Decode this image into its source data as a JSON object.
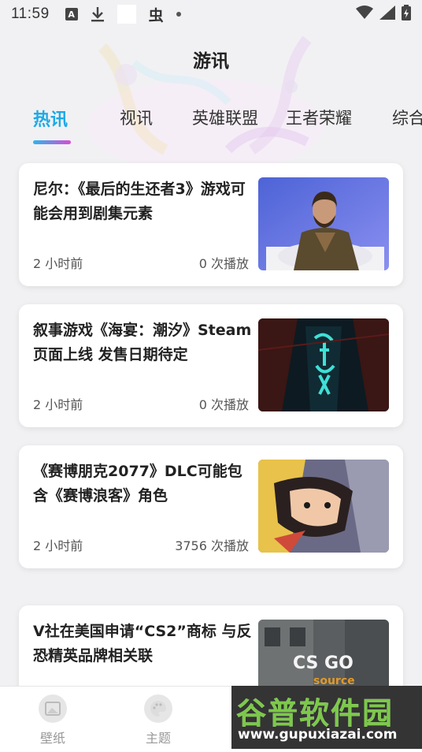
{
  "status_bar": {
    "time": "11:59",
    "icons": [
      "text-a-icon",
      "download-icon",
      "blank-square",
      "bug-icon",
      "notification-dot",
      "wifi-icon",
      "cell-signal-icon",
      "battery-icon"
    ],
    "bug_glyph": "虫",
    "a_glyph": "A"
  },
  "header": {
    "title": "游讯"
  },
  "tabs": [
    {
      "label": "热讯",
      "active": true
    },
    {
      "label": "视讯",
      "active": false
    },
    {
      "label": "英雄联盟",
      "active": false
    },
    {
      "label": "王者荣耀",
      "active": false
    },
    {
      "label": "综合",
      "active": false
    }
  ],
  "accent_color": "#1fa9e6",
  "news": [
    {
      "title": "尼尔：《最后的生还者3》游戏可能会用到剧集元素",
      "time": "2 小时前",
      "plays": "0 次播放",
      "thumb_icon": "man-interview-thumbnail"
    },
    {
      "title": "叙事游戏《海宴：潮汐》Steam页面上线 发售日期待定",
      "time": "2 小时前",
      "plays": "0 次播放",
      "thumb_icon": "haiyan-game-poster-thumbnail"
    },
    {
      "title": "《赛博朋克2077》DLC可能包含《赛博浪客》角色",
      "time": "2 小时前",
      "plays": "3756 次播放",
      "thumb_icon": "cyberpunk-anime-thumbnail"
    },
    {
      "title": "V社在美国申请“CS2”商标 与反恐精英品牌相关联",
      "time": "",
      "plays": "",
      "thumb_icon": "csgo-source-thumbnail"
    }
  ],
  "bottom_nav": [
    {
      "label": "壁纸",
      "icon": "wallpaper-icon"
    },
    {
      "label": "主题",
      "icon": "theme-palette-icon"
    }
  ],
  "watermark": {
    "big": "谷普软件园",
    "url": "www.gupuxiazai.com"
  }
}
